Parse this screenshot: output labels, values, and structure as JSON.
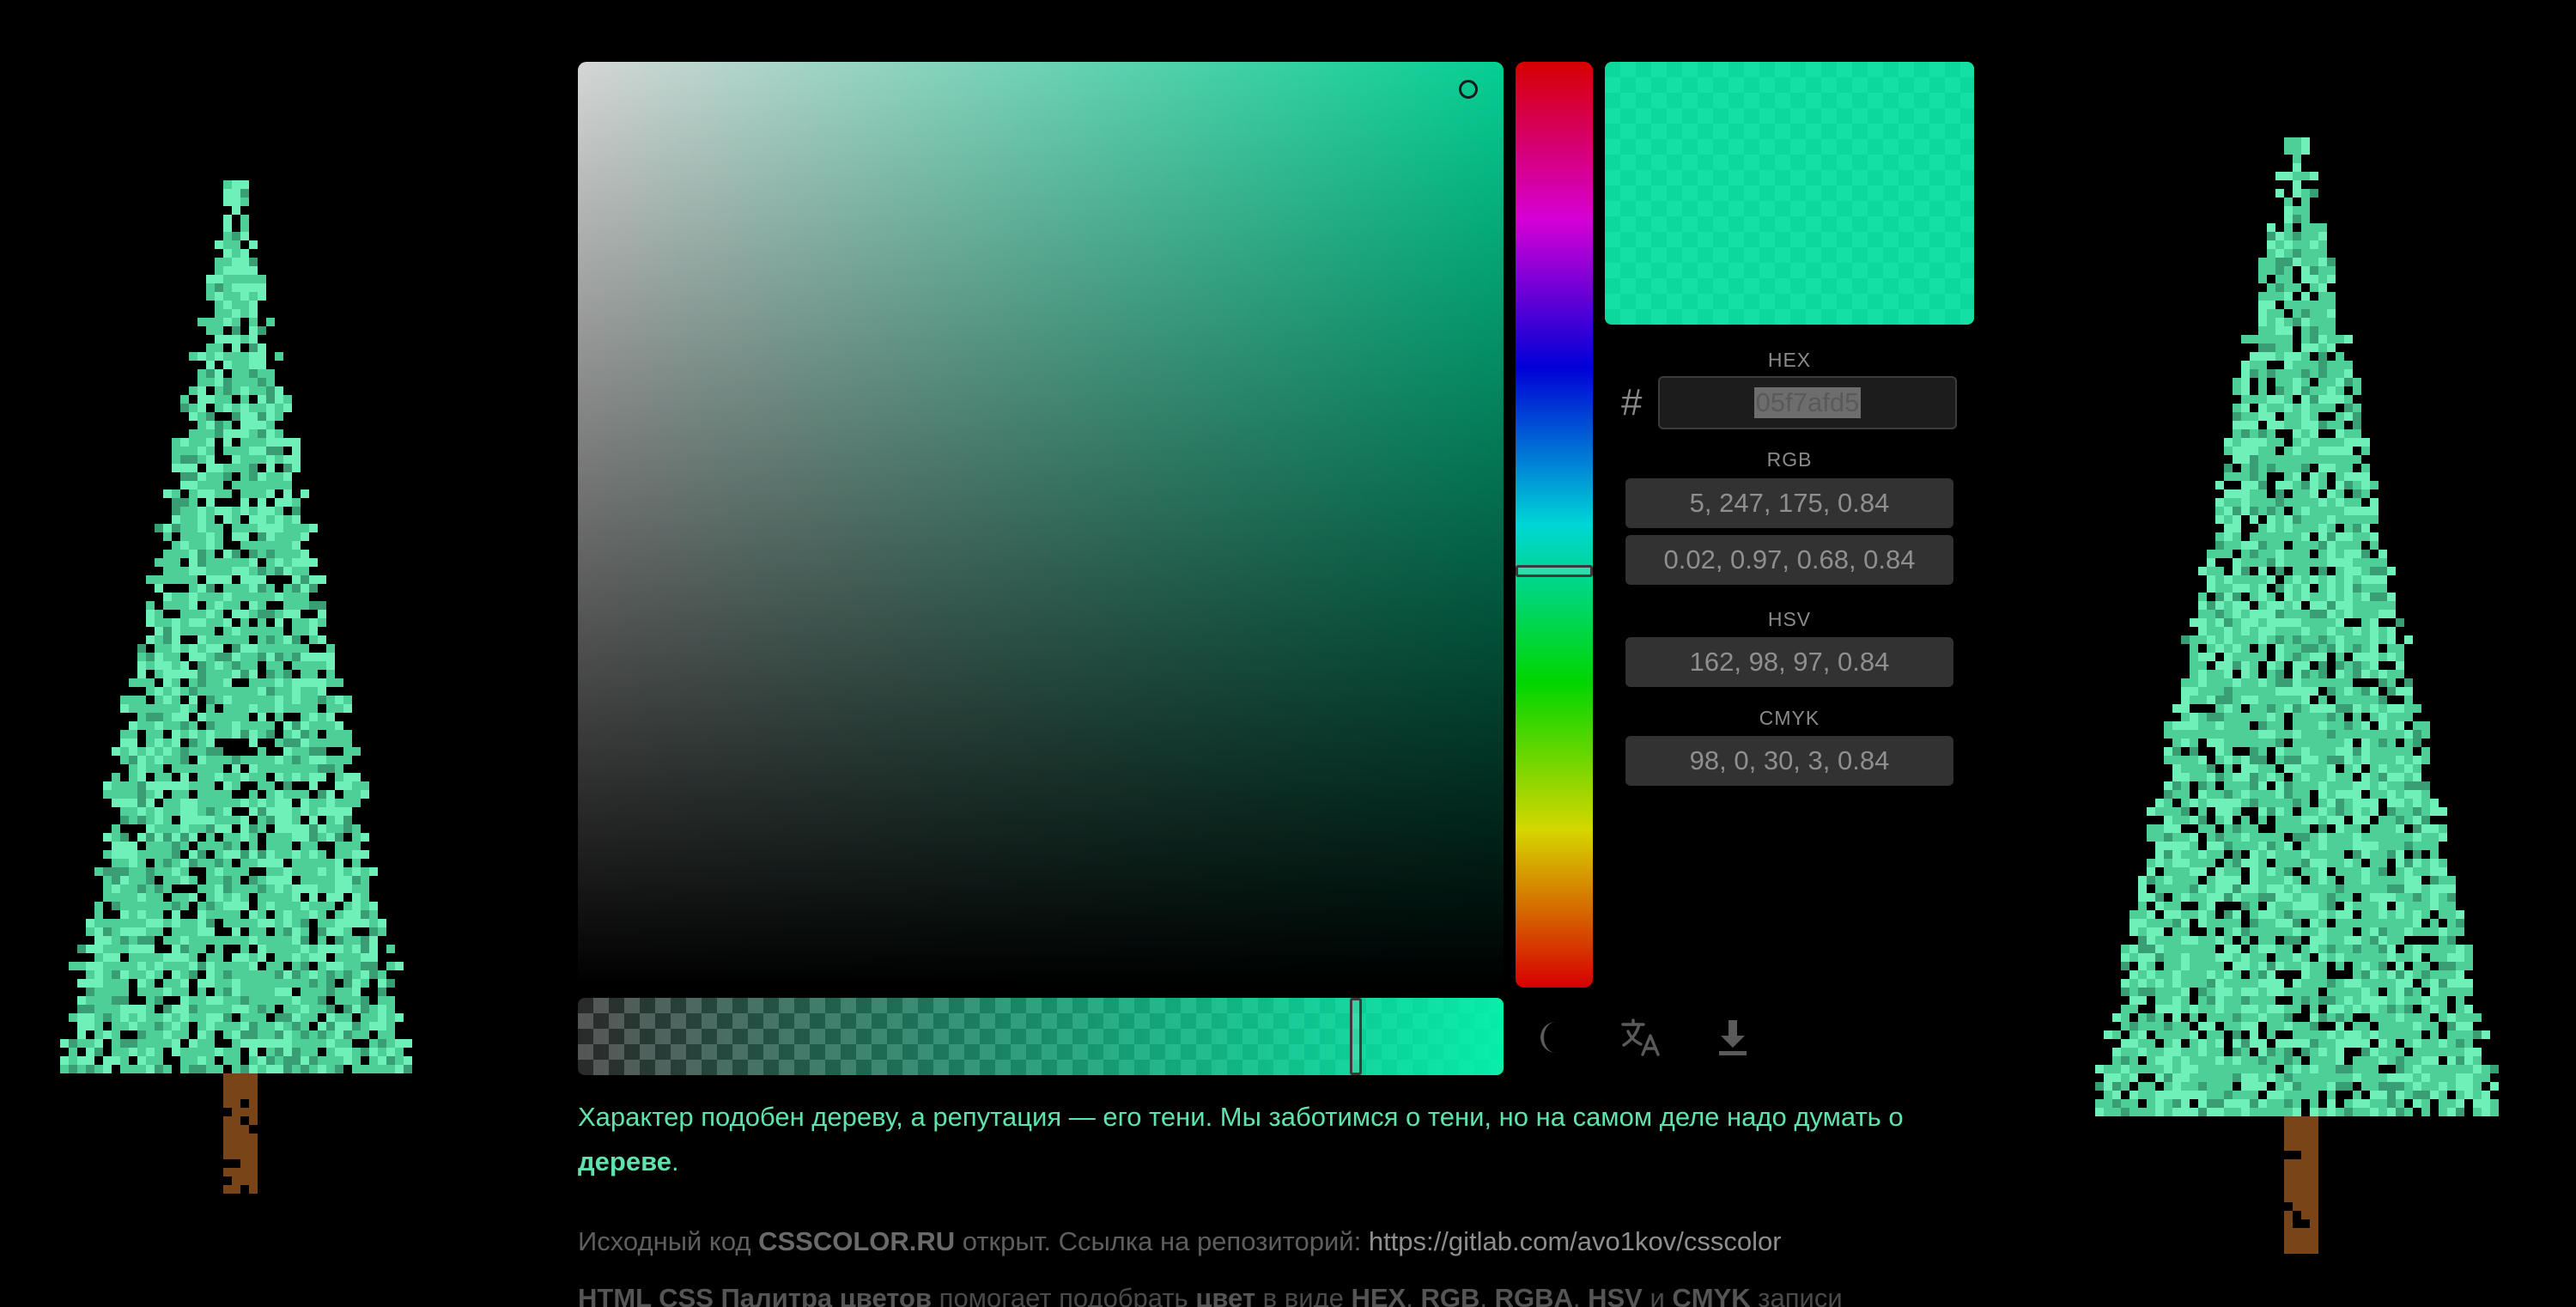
{
  "color": {
    "hex_value": "05f7afd5",
    "fill_rgba": "rgba(5, 247, 175, 0.84)",
    "hue": 162,
    "saturation": 98,
    "value": 97,
    "alpha": 0.84
  },
  "fields": {
    "hex_label": "HEX",
    "hash_symbol": "#",
    "rgb_label": "RGB",
    "rgb_value": "5, 247, 175, 0.84",
    "rgb_float_value": "0.02, 0.97, 0.68, 0.84",
    "hsv_label": "HSV",
    "hsv_value": "162, 98, 97, 0.84",
    "cmyk_label": "CMYK",
    "cmyk_value": "98, 0, 30, 3, 0.84"
  },
  "toolbar": {
    "items": [
      {
        "name": "theme-toggle",
        "icon": "moon-icon"
      },
      {
        "name": "language-toggle",
        "icon": "translate-icon"
      },
      {
        "name": "download",
        "icon": "download-icon"
      }
    ]
  },
  "quote": {
    "text_before": "Характер подобен дереву, а репутация — его тени. Мы заботимся о тени, но на самом деле надо думать о ",
    "emphasis": "дереве",
    "text_after": "."
  },
  "source": {
    "prefix": "Исходный код ",
    "brand": "CSSCOLOR.RU",
    "middle": " открыт. Ссылка на репозиторий: ",
    "link": "https://gitlab.com/avo1kov/csscolor"
  },
  "description": {
    "part1": "HTML CSS Палитра цветов",
    "part2": " помогает подобрать ",
    "part3": "цвет",
    "part4": " в виде ",
    "part5": "HEX",
    "part6": ", ",
    "part7": "RGB",
    "part8": ", ",
    "part9": "RGBA",
    "part10": ", ",
    "part11": "HSV",
    "part12": " и ",
    "part13": "CMYK",
    "part14": " записи"
  },
  "colors": {
    "tree_light": "#6ef0b8",
    "tree_main": "#4fcf98",
    "tree_dark": "#3a9e74",
    "tree_shadow": "#000000",
    "trunk": "#7a4419",
    "quote_text": "#5fe3ad"
  }
}
